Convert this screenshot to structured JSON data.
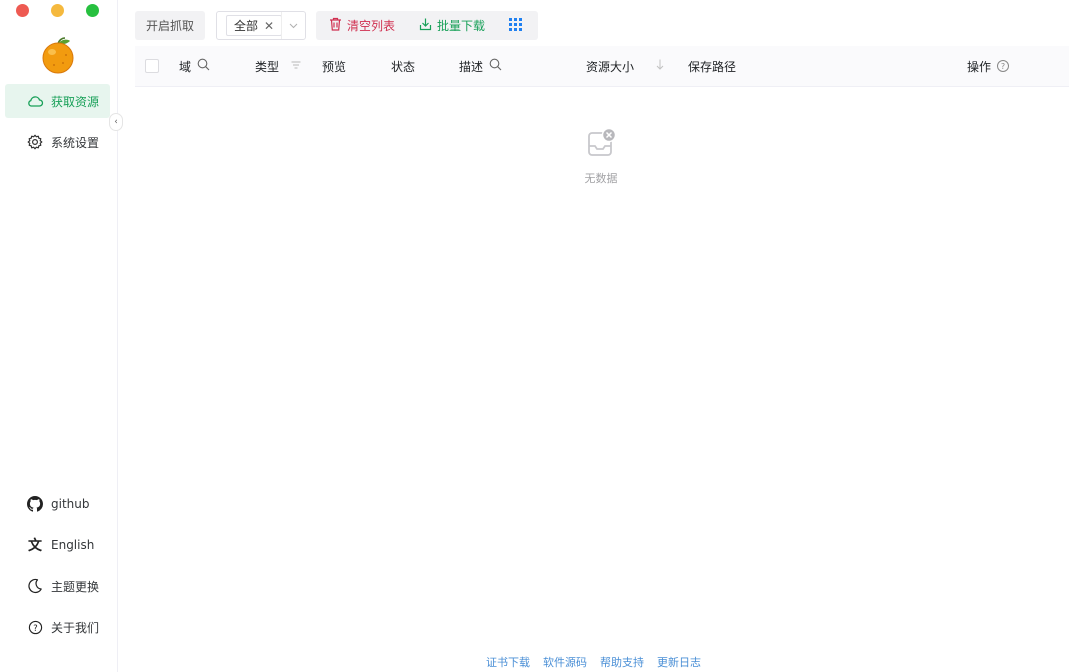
{
  "window": {
    "controls": [
      "close",
      "minimize",
      "maximize"
    ]
  },
  "sidebar": {
    "nav": [
      {
        "label": "获取资源",
        "icon": "cloud-icon",
        "active": true
      },
      {
        "label": "系统设置",
        "icon": "gear-icon",
        "active": false
      }
    ],
    "bottom": [
      {
        "label": "github",
        "icon": "github-icon"
      },
      {
        "label": "English",
        "icon": "translate-icon"
      },
      {
        "label": "主题更换",
        "icon": "moon-icon"
      },
      {
        "label": "关于我们",
        "icon": "help-circle-icon"
      }
    ]
  },
  "toolbar": {
    "capture_label": "开启抓取",
    "filter": {
      "selected_tag": "全部"
    },
    "clear_label": "清空列表",
    "batch_download_label": "批量下载"
  },
  "table": {
    "columns": {
      "domain": "域",
      "type": "类型",
      "preview": "预览",
      "status": "状态",
      "description": "描述",
      "size": "资源大小",
      "save_path": "保存路径",
      "actions": "操作"
    },
    "rows": [],
    "empty_text": "无数据"
  },
  "footer": {
    "links": [
      "证书下载",
      "软件源码",
      "帮助支持",
      "更新日志"
    ]
  },
  "colors": {
    "accent_green": "#18a058",
    "danger_red": "#d03050",
    "link_blue": "#4a8fd6"
  }
}
